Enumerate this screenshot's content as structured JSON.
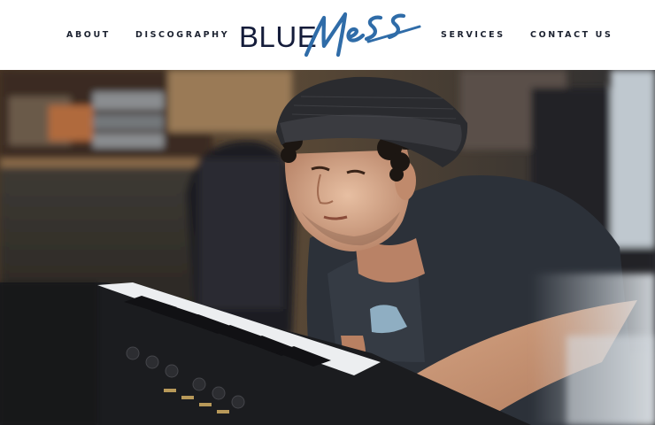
{
  "nav": {
    "about": "ABOUT",
    "discography": "DISCOGRAPHY",
    "services": "SERVICES",
    "contact": "CONTACT US"
  },
  "logo": {
    "word_blue": "BLUE",
    "word_mess": "MESS",
    "color_blue": "#141c3a",
    "color_mess": "#2f6ca8"
  },
  "hero": {
    "image_subject": "musician-at-keyboard-photo"
  }
}
